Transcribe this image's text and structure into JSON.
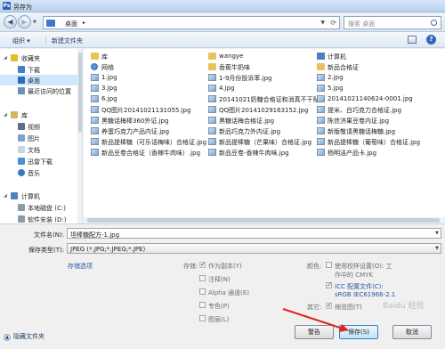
{
  "window": {
    "title": "另存为",
    "icon": "save-as-icon"
  },
  "address": {
    "crumbs": [
      "桌面"
    ],
    "search_placeholder": "搜索 桌面"
  },
  "toolbar": {
    "organize": "组织 ▾",
    "new_folder": "新建文件夹"
  },
  "nav": {
    "favorites": "收藏夹",
    "downloads": "下载",
    "desktop": "桌面",
    "recent": "最近访问的位置",
    "libraries": "库",
    "videos": "视频",
    "pictures": "图片",
    "documents": "文档",
    "thunder": "迅雷下载",
    "music": "音乐",
    "computer": "计算机",
    "local_c": "本地磁盘 (C:)",
    "software_d": "软件安装 (D:)"
  },
  "files": {
    "col1": [
      "库",
      "网络",
      "1.jpg",
      "3.jpg",
      "6.jpg",
      "QQ图片20141021131055.jpg",
      "黑糖话梅棒360外证.jpg",
      "养蛋巧克力产品内证.jpg",
      "新品提棒糖（可乐话梅味）合格证.jpg",
      "新品豆卷合格证（香辣牛肉味）.jpg"
    ],
    "col2": [
      "wangye",
      "香蕉牛奶味",
      "1-9月份投诉率.jpg",
      "4.jpg",
      "20141021奶糖合格证和消真不干贴...",
      "QQ图片20141029163152.jpg",
      "黑糖话梅合格证.jpg",
      "新品巧克力外内证.jpg",
      "新品提棒糖（芒果味）合格证.jpg",
      "新品豆卷-香辣牛肉味.jpg"
    ],
    "col3": [
      "计算机",
      "新品合格证",
      "2.jpg",
      "5.jpg",
      "20141021140624-0001.jpg",
      "提米、白巧克力合格证.jpg",
      "陈信济果豆卷内证.jpg",
      "新版敬请黑糖话梅糖.jpg",
      "新品提棒糖（葡萄味）合格证.jpg",
      "杨明洁产品卡.jpg"
    ]
  },
  "form": {
    "filename_label": "文件名(N):",
    "filename_value": "坦棒糖配方-1.jpg",
    "filetype_label": "保存类型(T):",
    "filetype_value": "JPEG (*.JPG;*.JPEG;*.JPE)",
    "options_link": "存储选项",
    "storage_label": "存储:",
    "storage_opts": [
      "作为副本(Y)",
      "注释(N)",
      "Alpha 通道(E)",
      "专色(P)",
      "图层(L)"
    ],
    "color_label": "颜色:",
    "proof_text_1": "使用校样设置(O):  工",
    "proof_text_2": "作中的 CMYK",
    "icc_line_1": "ICC 配置文件(C):",
    "icc_line_2": "sRGB IEC61966-2.1",
    "other_label": "其它:",
    "thumbnail": "缩览图(T)",
    "hide_folders": "隐藏文件夹",
    "buttons": {
      "warning": "警告",
      "save": "保存(S)",
      "cancel": "取消"
    }
  },
  "watermark": "Baidu 经验"
}
